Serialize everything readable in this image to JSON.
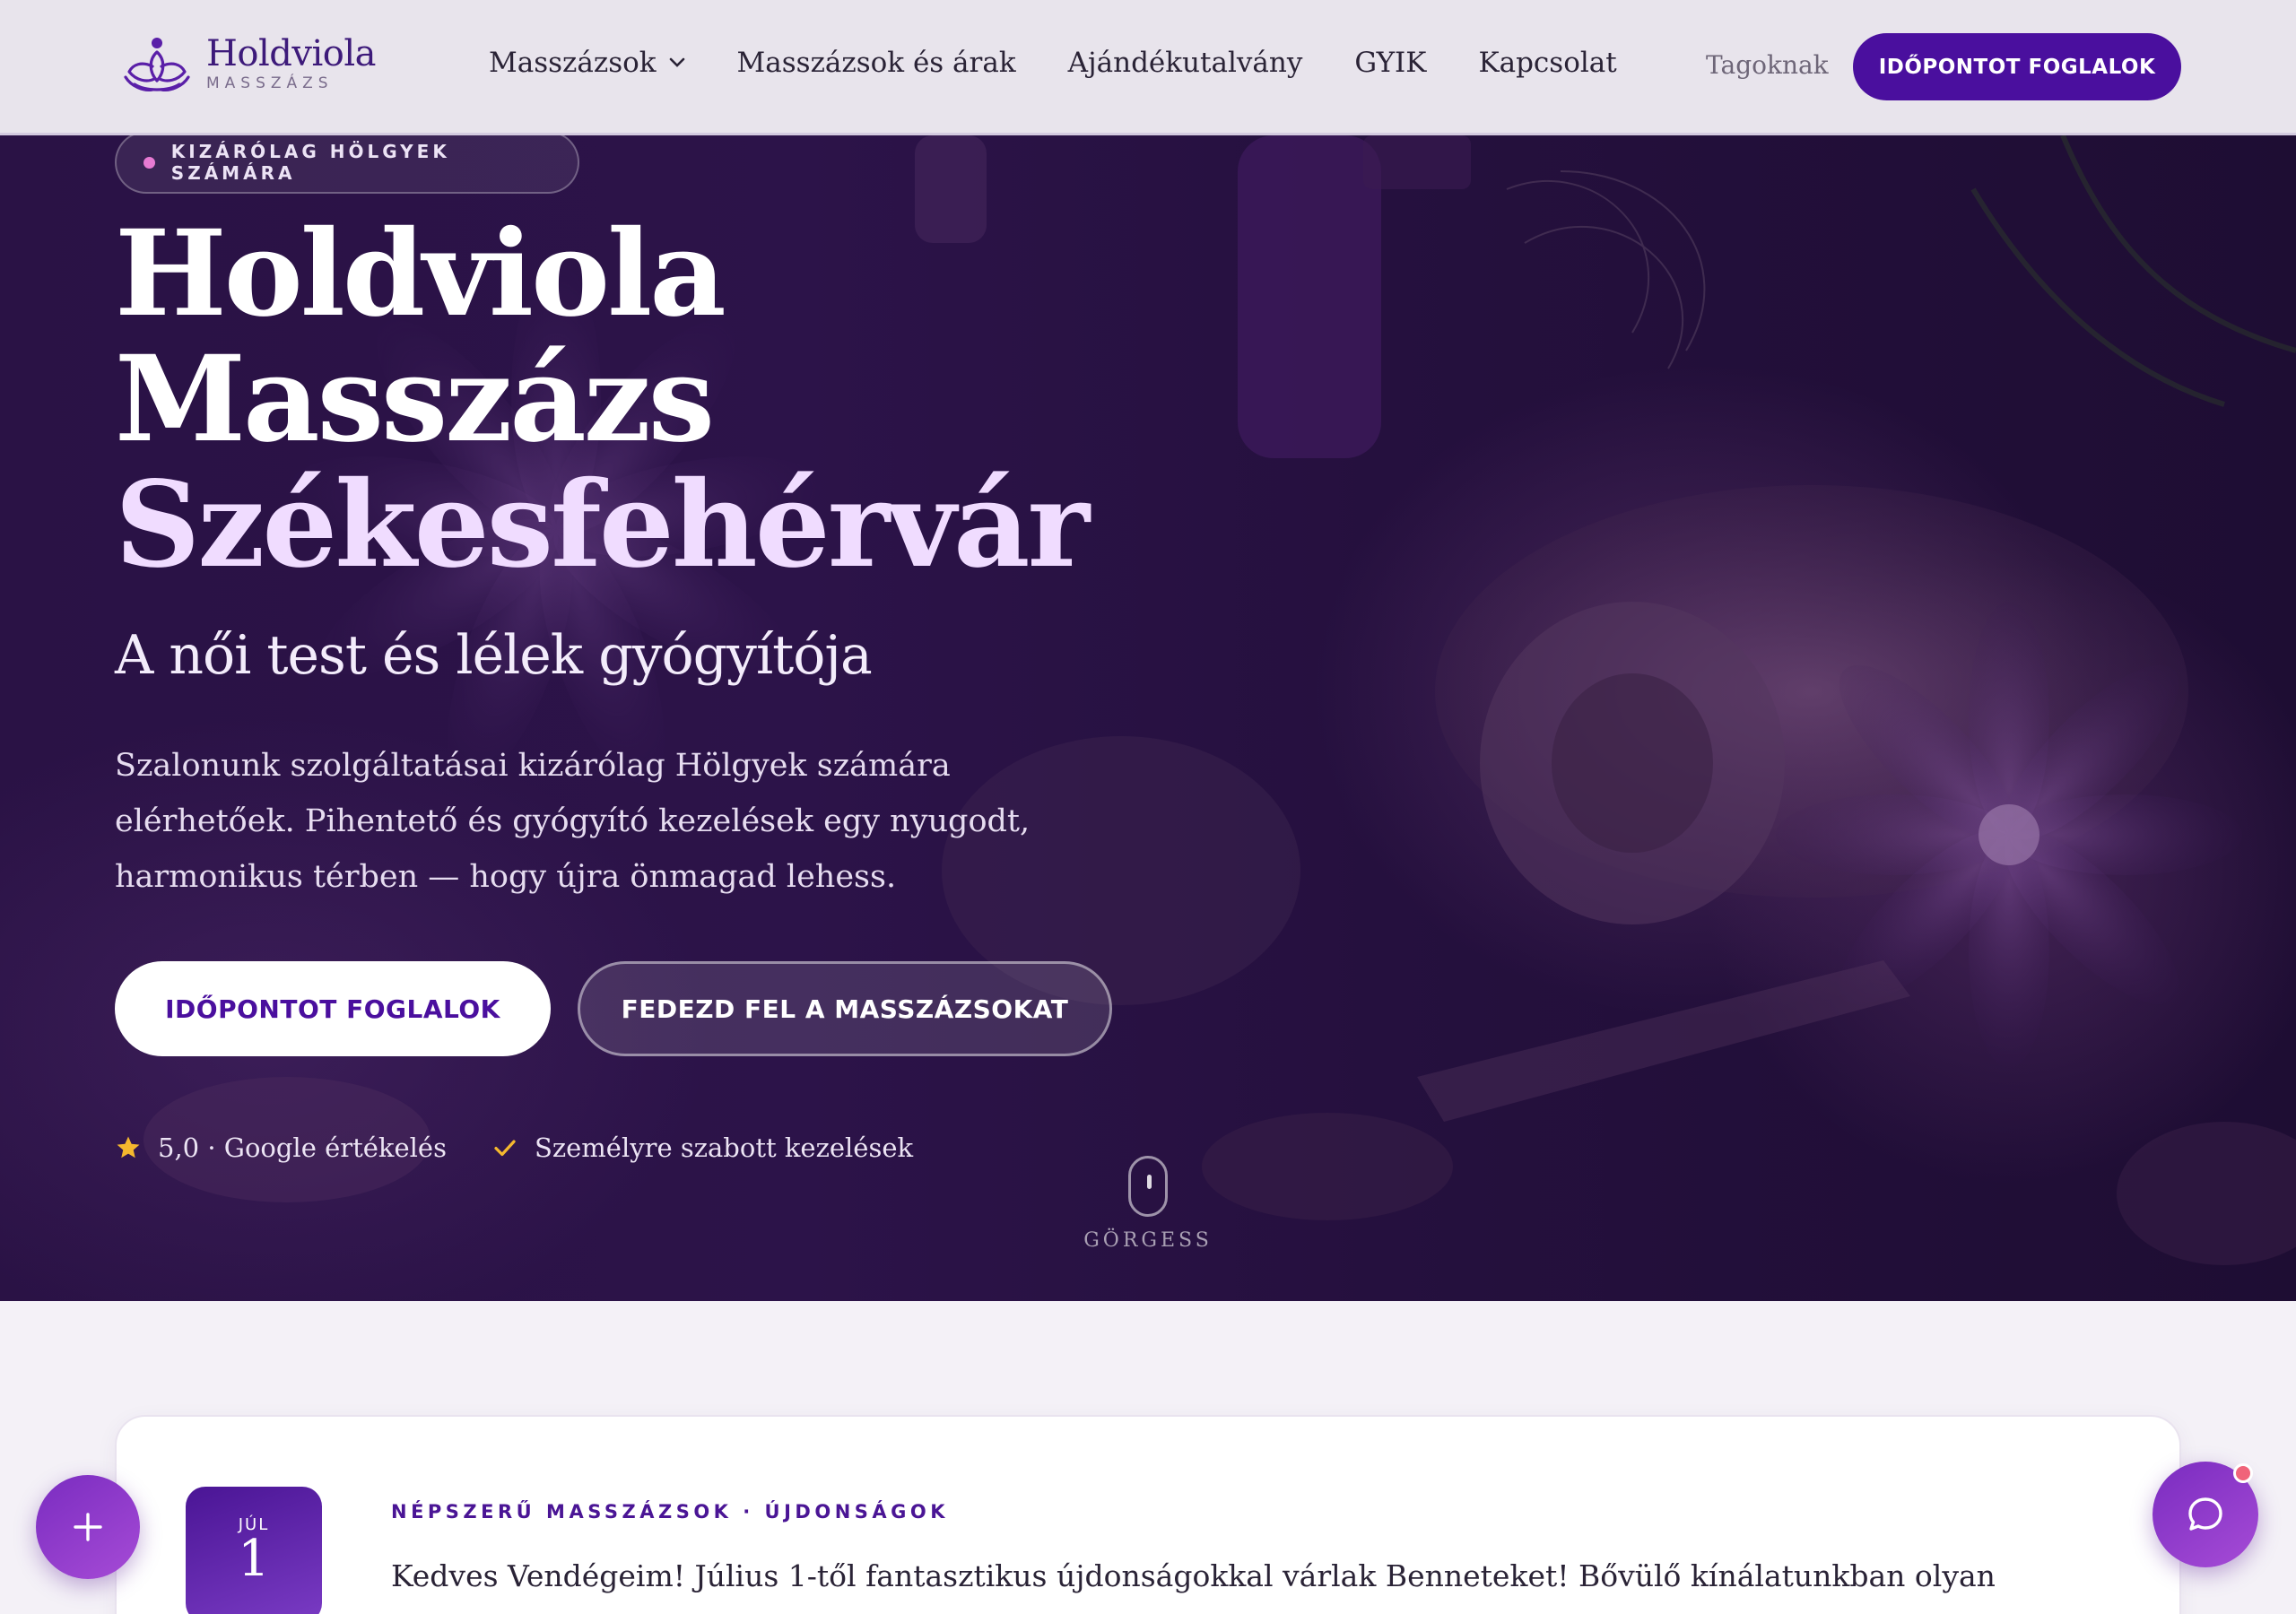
{
  "brand": {
    "name": "Holdviola",
    "sub": "MASSZÁZS",
    "logo_icon": "lotus-yoga-icon"
  },
  "nav": {
    "items": [
      {
        "label": "Masszázsok",
        "has_dropdown": true
      },
      {
        "label": "Masszázsok és árak"
      },
      {
        "label": "Ajándékutalvány"
      },
      {
        "label": "GYIK"
      },
      {
        "label": "Kapcsolat"
      }
    ],
    "members_label": "Tagoknak",
    "cta_label": "IDŐPONTOT FOGLALOK"
  },
  "hero": {
    "badge": "KIZÁRÓLAG HÖLGYEK SZÁMÁRA",
    "title_line1": "Holdviola",
    "title_line2": "Masszázs",
    "title_line3": "Székesfehérvár",
    "tagline": "A női test és lélek gyógyítója",
    "intro_line1": "Szalonunk szolgáltatásai kizárólag Hölgyek számára",
    "intro_line2": "elérhetőek. Pihentető és gyógyító kezelések egy nyugodt,",
    "intro_line3": "harmonikus térben — hogy újra önmagad lehess.",
    "primary_button": "IDŐPONTOT FOGLALOK",
    "secondary_button": "FEDEZD FEL A MASSZÁZSOKAT",
    "trust": [
      {
        "icon": "star-icon",
        "text": "5,0 · Google értékelés"
      },
      {
        "icon": "check-icon",
        "text": "Személyre szabott kezelések"
      }
    ],
    "scroll_label": "GÖRGESS"
  },
  "news": {
    "month": "JÚL",
    "day": "1",
    "category": "NÉPSZERŰ MASSZÁZSOK · ÚJDONSÁGOK",
    "text_line1": "Kedves Vendégeim! Július 1-től fantasztikus újdonságokkal várlak Benneteket! Bővülő kínálatunkban olyan különleges"
  },
  "colors": {
    "brand_purple": "#4a0f9e",
    "accent_pink": "#e77ad3",
    "star_yellow": "#f5b82e",
    "fab_purple": "#8a35c9"
  }
}
